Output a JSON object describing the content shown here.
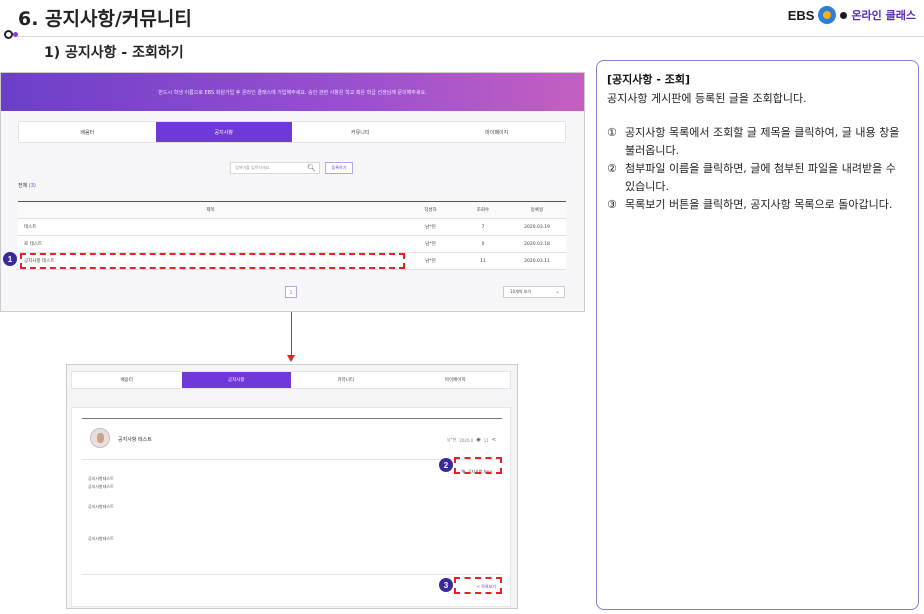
{
  "header": {
    "title": "6. 공지사항/커뮤니티",
    "subtitle": "1) 공지사항 - 조회하기",
    "logo": {
      "ebs": "EBS",
      "online": "온라인 클래스"
    }
  },
  "shot1": {
    "banner_text": "반드시 학생 이름으로 EBS 회원가입 후 온라인 클래스에 가입해주세요. 승인 관련 사항은 학교 혹은 학급 선생님께 문의해주세요.",
    "tabs": [
      "배움터",
      "공지사항",
      "커뮤니티",
      "마이페이지"
    ],
    "active_tab": 1,
    "search_placeholder": "검색어를 입력하세요.",
    "register_label": "등록하기",
    "total_label": "전체",
    "total_count": "(3)",
    "columns": {
      "title": "제목",
      "writer": "작성자",
      "views": "조회수",
      "date": "등록일"
    },
    "rows": [
      {
        "title": "테스트",
        "writer": "남*현",
        "views": "7",
        "date": "2020.03.19"
      },
      {
        "title": "로 테스트",
        "writer": "남*현",
        "views": "0",
        "date": "2020.03.18"
      },
      {
        "title": "공지사항 테스트",
        "writer": "남*현",
        "views": "11",
        "date": "2020.03.11"
      }
    ],
    "page": "1",
    "view_select": "10개씩 보기"
  },
  "shot2": {
    "tabs": [
      "배움터",
      "공지사항",
      "커뮤니티",
      "마이페이지"
    ],
    "active_tab": 1,
    "post_title": "공지사항 테스트",
    "writer": "남*현",
    "date": "2020.0",
    "views": "11",
    "attachment": "공지사항.hwp",
    "content_lines": [
      "공지사항테스트",
      "공지사항테스트",
      "공지사항테스트",
      "공지사항테스트"
    ],
    "list_button": "목록보기"
  },
  "badges": [
    "1",
    "2",
    "3"
  ],
  "panel": {
    "heading": "[공지사항 - 조회]",
    "desc": "공지사항 게시판에 등록된 글을 조회합니다.",
    "steps": [
      {
        "num": "①",
        "text": "공지사항 목록에서 조회할 글 제목을 클릭하여, 글 내용 창을 불러옵니다."
      },
      {
        "num": "②",
        "text": "첨부파일 이름을 클릭하면, 글에 첨부된 파일을 내려받을 수 있습니다."
      },
      {
        "num": "③",
        "text": "목록보기 버튼을 클릭하면, 공지사항 목록으로 돌아갑니다."
      }
    ]
  },
  "colors": {
    "accent": "#6f38d8",
    "highlight": "#e8202a",
    "badge": "#3a2a9c"
  }
}
